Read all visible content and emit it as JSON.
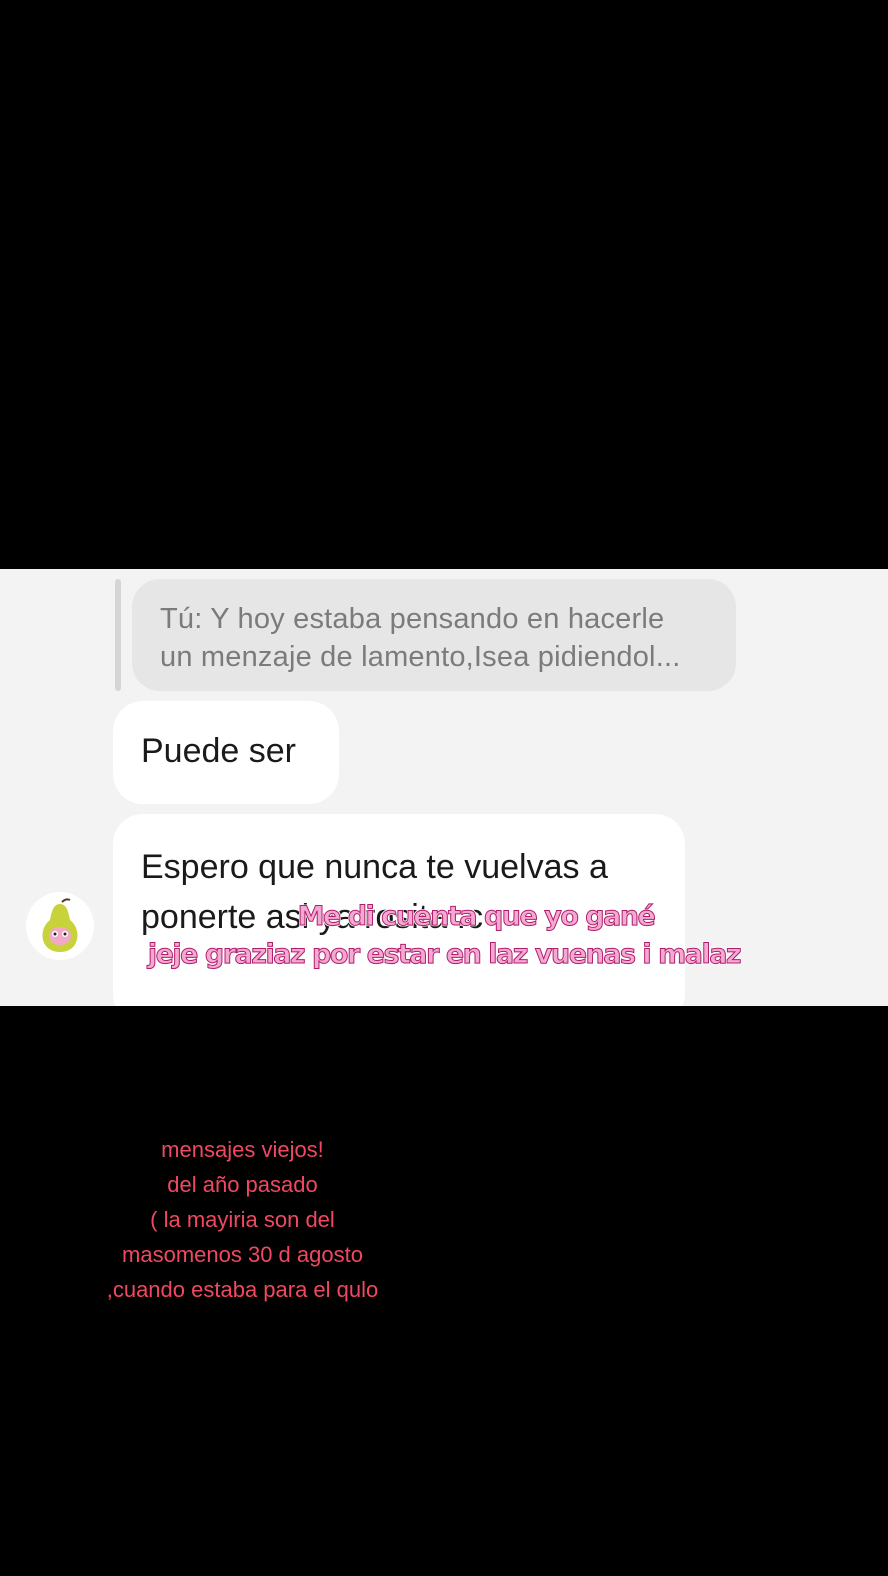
{
  "chat": {
    "reply_preview": {
      "lines": [
        "Tú: Y hoy estaba pensando en hacerle",
        "un menzaje de lamento,Isea pidiendol..."
      ]
    },
    "messages": [
      {
        "lines": [
          "Puede ser"
        ]
      },
      {
        "lines": [
          "Espero que nunca te vuelvas a",
          "ponerte asi ya rosita :c"
        ]
      }
    ],
    "avatar_icon": "pear-avatar-icon"
  },
  "overlay_caption": {
    "line1": "Me di cuenta que yo gané",
    "line2": "jeje graziaz por estar en laz vuenas i malaz"
  },
  "side_note": {
    "lines": [
      "mensajes viejos!",
      "del año pasado",
      "( la mayiria son del",
      "masomenos 30 d agosto",
      ",cuando estaba para el qulo"
    ]
  },
  "colors": {
    "background": "#000000",
    "chat_panel": "#f3f3f3",
    "reply_bubble": "#e6e6e6",
    "message_bubble": "#ffffff",
    "caption_fill": "#f4a9d4",
    "caption_stroke": "#b01e6a",
    "side_note": "#f04860"
  }
}
